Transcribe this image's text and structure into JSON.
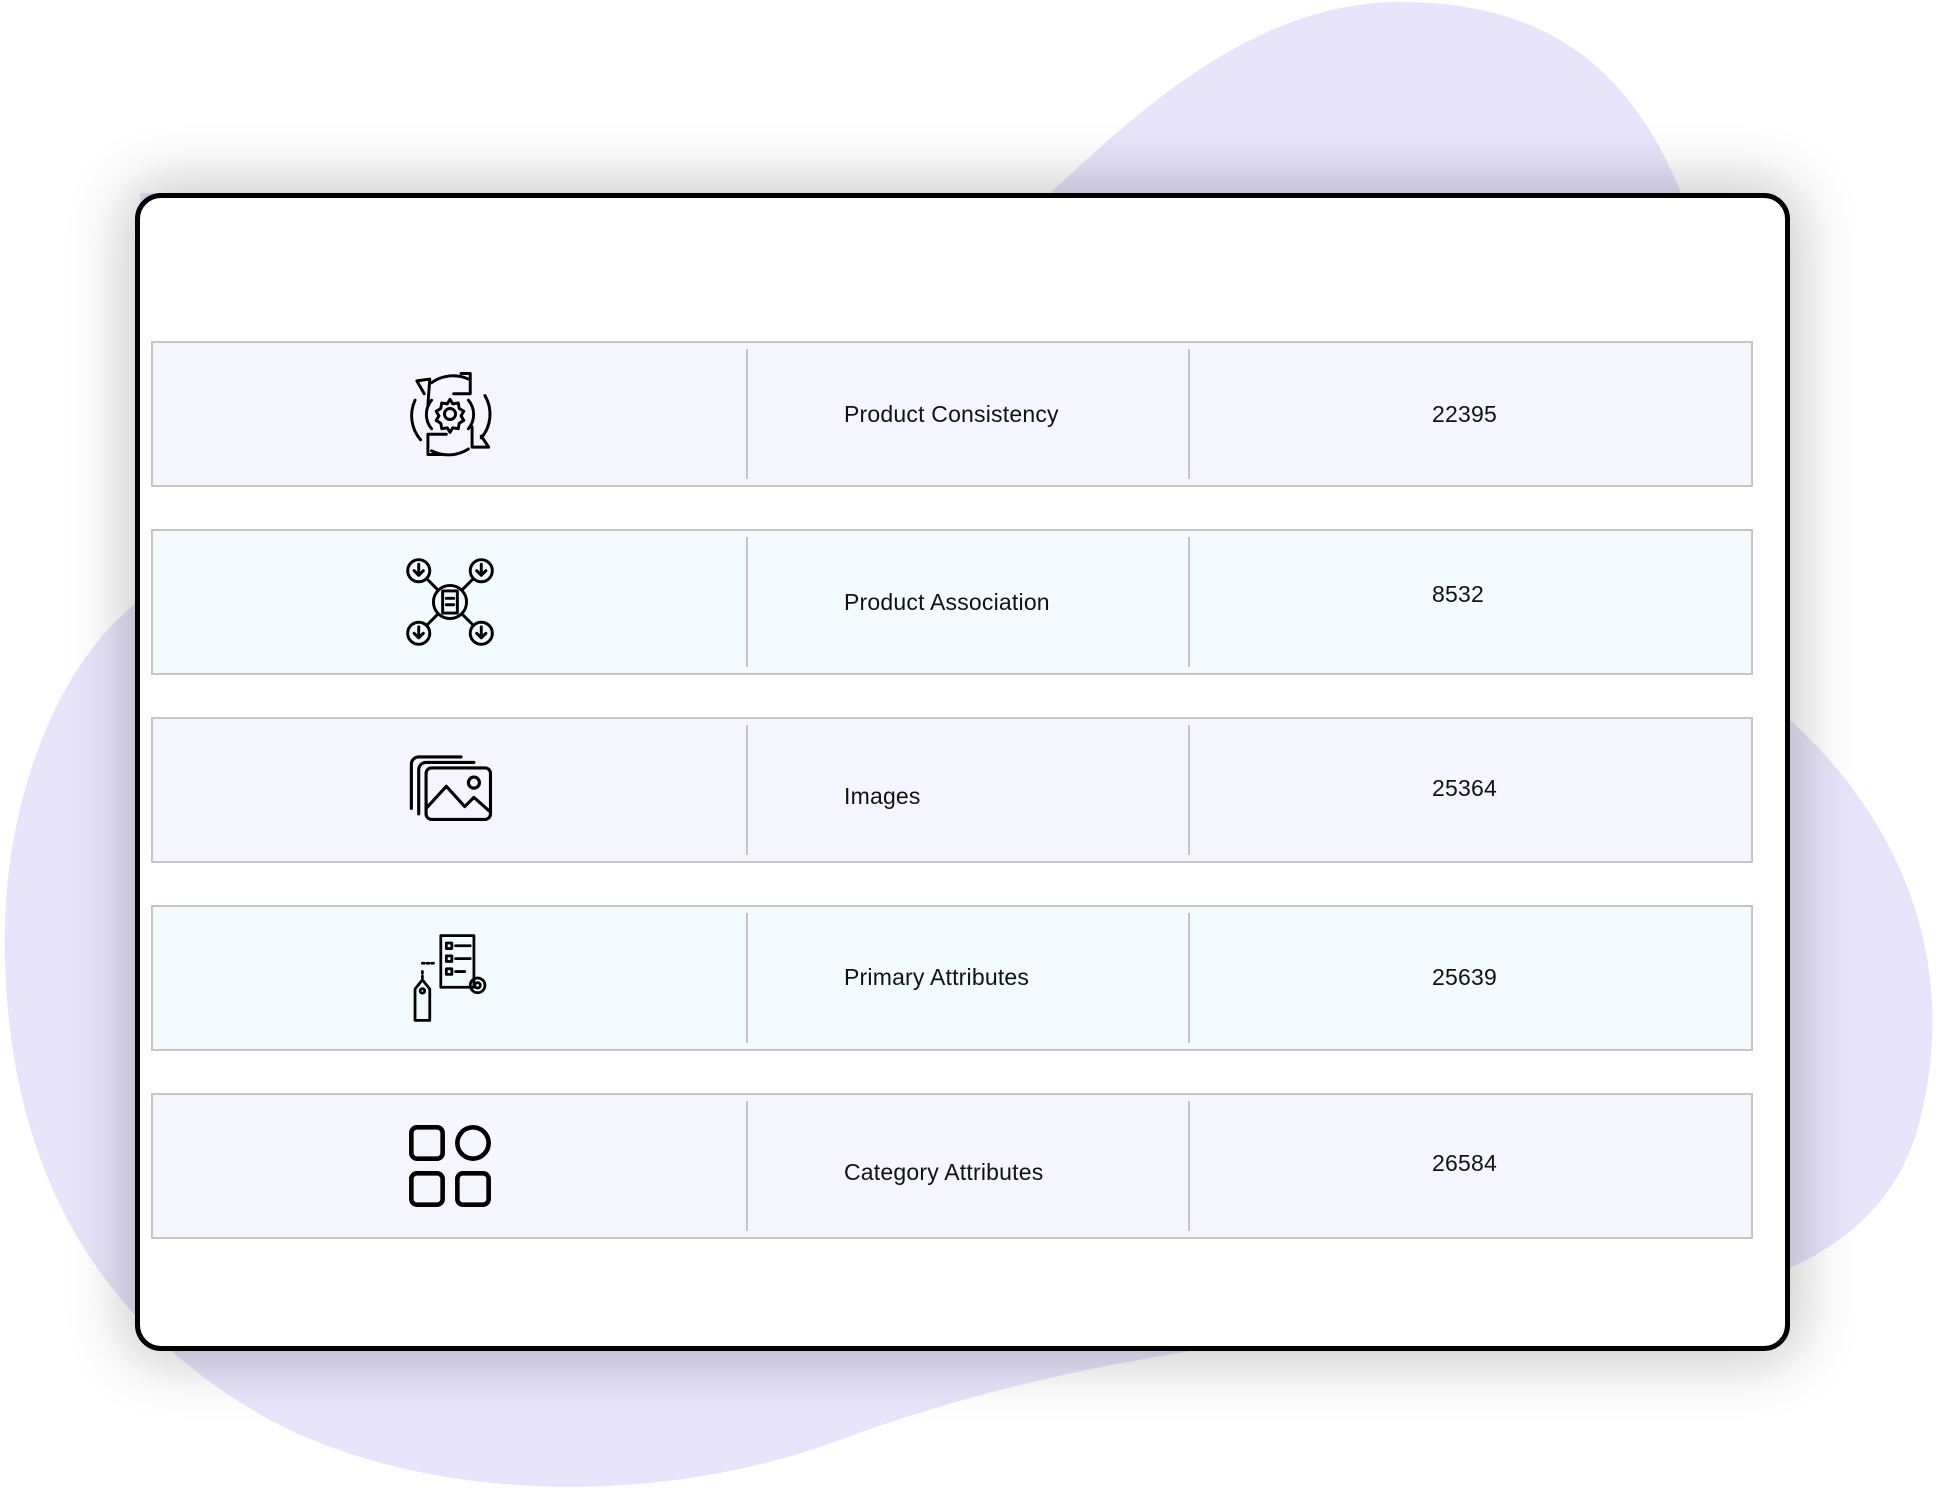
{
  "colors": {
    "background_blob": "#e7e4fc",
    "card_border": "#000000",
    "row_odd": "#f5f5fe",
    "row_even": "#f2fafe",
    "row_border": "#cbc4c7",
    "text": "#111111"
  },
  "rows": [
    {
      "icon": "gear-cycle-icon",
      "label": "Product Consistency",
      "value": "22395"
    },
    {
      "icon": "product-network-icon",
      "label": "Product Association",
      "value": "8532"
    },
    {
      "icon": "image-stack-icon",
      "label": "Images",
      "value": "25364"
    },
    {
      "icon": "tag-checklist-gear-icon",
      "label": "Primary Attributes",
      "value": "25639"
    },
    {
      "icon": "category-grid-icon",
      "label": "Category Attributes",
      "value": "26584"
    }
  ]
}
